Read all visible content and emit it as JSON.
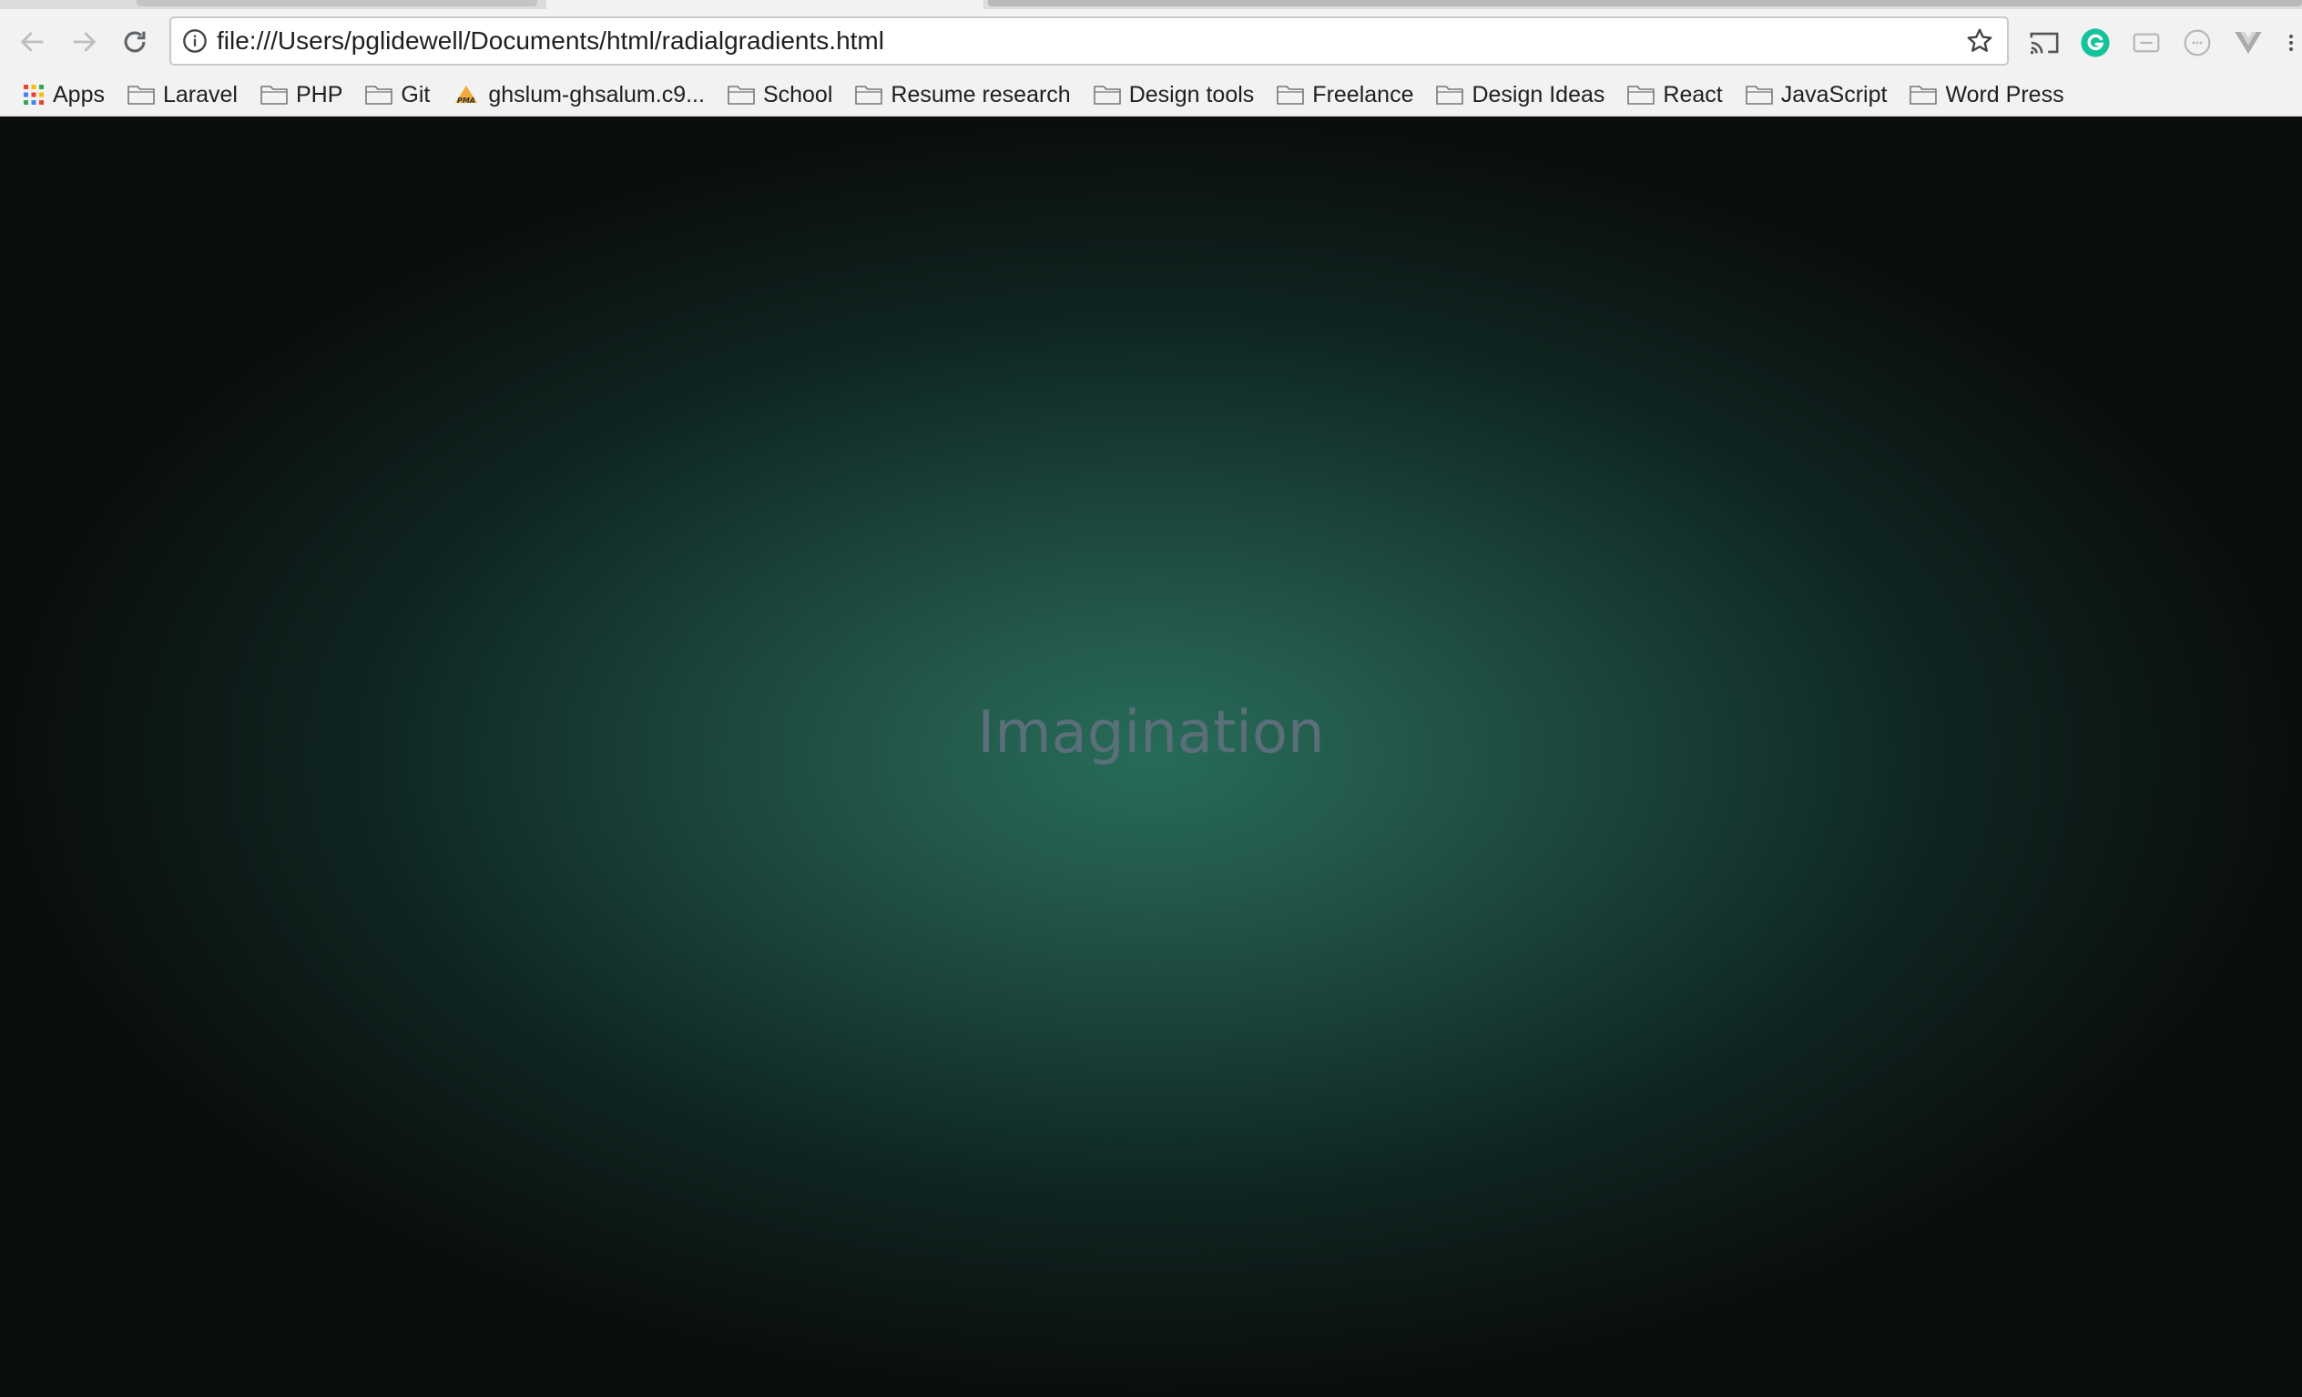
{
  "browser": {
    "url": "file:///Users/pglidewell/Documents/html/radialgradients.html"
  },
  "bookmarks": [
    {
      "label": "Apps",
      "icon": "apps-grid-icon"
    },
    {
      "label": "Laravel",
      "icon": "folder-icon"
    },
    {
      "label": "PHP",
      "icon": "folder-icon"
    },
    {
      "label": "Git",
      "icon": "folder-icon"
    },
    {
      "label": "ghslum-ghsalum.c9...",
      "icon": "pma-icon"
    },
    {
      "label": "School",
      "icon": "folder-icon"
    },
    {
      "label": "Resume research",
      "icon": "folder-icon"
    },
    {
      "label": "Design tools",
      "icon": "folder-icon"
    },
    {
      "label": "Freelance",
      "icon": "folder-icon"
    },
    {
      "label": "Design Ideas",
      "icon": "folder-icon"
    },
    {
      "label": "React",
      "icon": "folder-icon"
    },
    {
      "label": "JavaScript",
      "icon": "folder-icon"
    },
    {
      "label": "Word Press",
      "icon": "folder-icon"
    }
  ],
  "page": {
    "headline": "Imagination"
  },
  "colors": {
    "gradient_center": "#276b59",
    "gradient_edge": "#0a0e0d",
    "headline": "#5a6f7a",
    "grammarly": "#15c39a"
  }
}
